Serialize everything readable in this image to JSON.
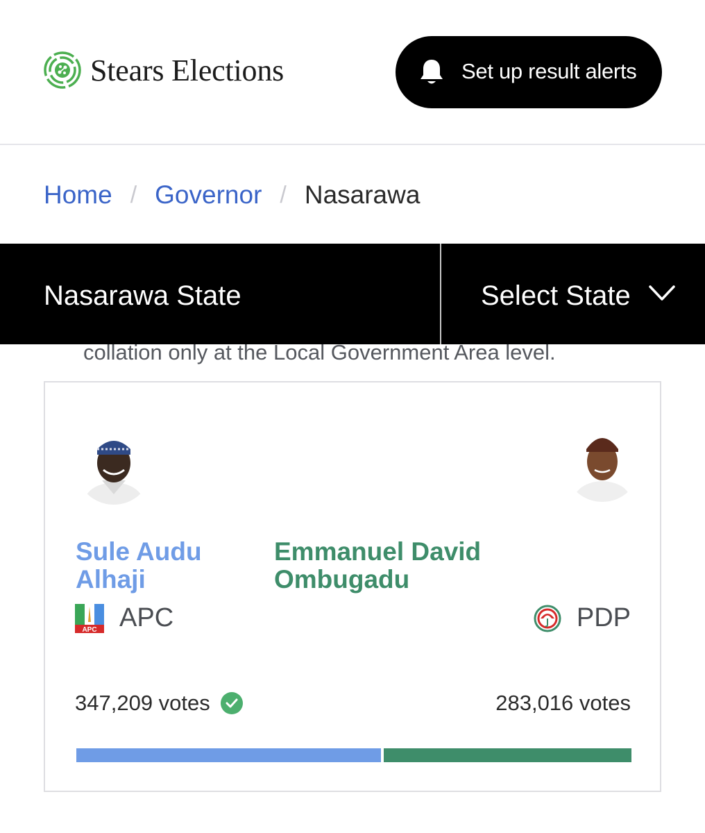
{
  "header": {
    "brand": "Stears Elections",
    "alert_button": "Set up result alerts"
  },
  "breadcrumb": {
    "home": "Home",
    "section": "Governor",
    "current": "Nasarawa",
    "separator": "/"
  },
  "statebar": {
    "state_name": "Nasarawa State",
    "select_label": "Select State"
  },
  "note": "collation only at the Local Government Area level.",
  "result": {
    "candidates": [
      {
        "name": "Sule Audu Alhaji",
        "party": "APC",
        "votes": "347,209 votes",
        "vote_count": 347209,
        "color": "#6f9ce6",
        "winner": true
      },
      {
        "name": "Emmanuel David Ombugadu",
        "party": "PDP",
        "votes": "283,016 votes",
        "vote_count": 283016,
        "color": "#3e8d6a",
        "winner": false
      }
    ]
  },
  "colors": {
    "brand_green": "#4caf50",
    "link_blue": "#3a64c8",
    "apc_blue": "#6f9ce6",
    "pdp_green": "#3e8d6a",
    "winner_check": "#4caf6e"
  },
  "icons": {
    "logo": "fingerprint-logo-icon",
    "alert": "bell-icon",
    "select": "chevron-down-icon",
    "winner": "check-circle-icon"
  }
}
